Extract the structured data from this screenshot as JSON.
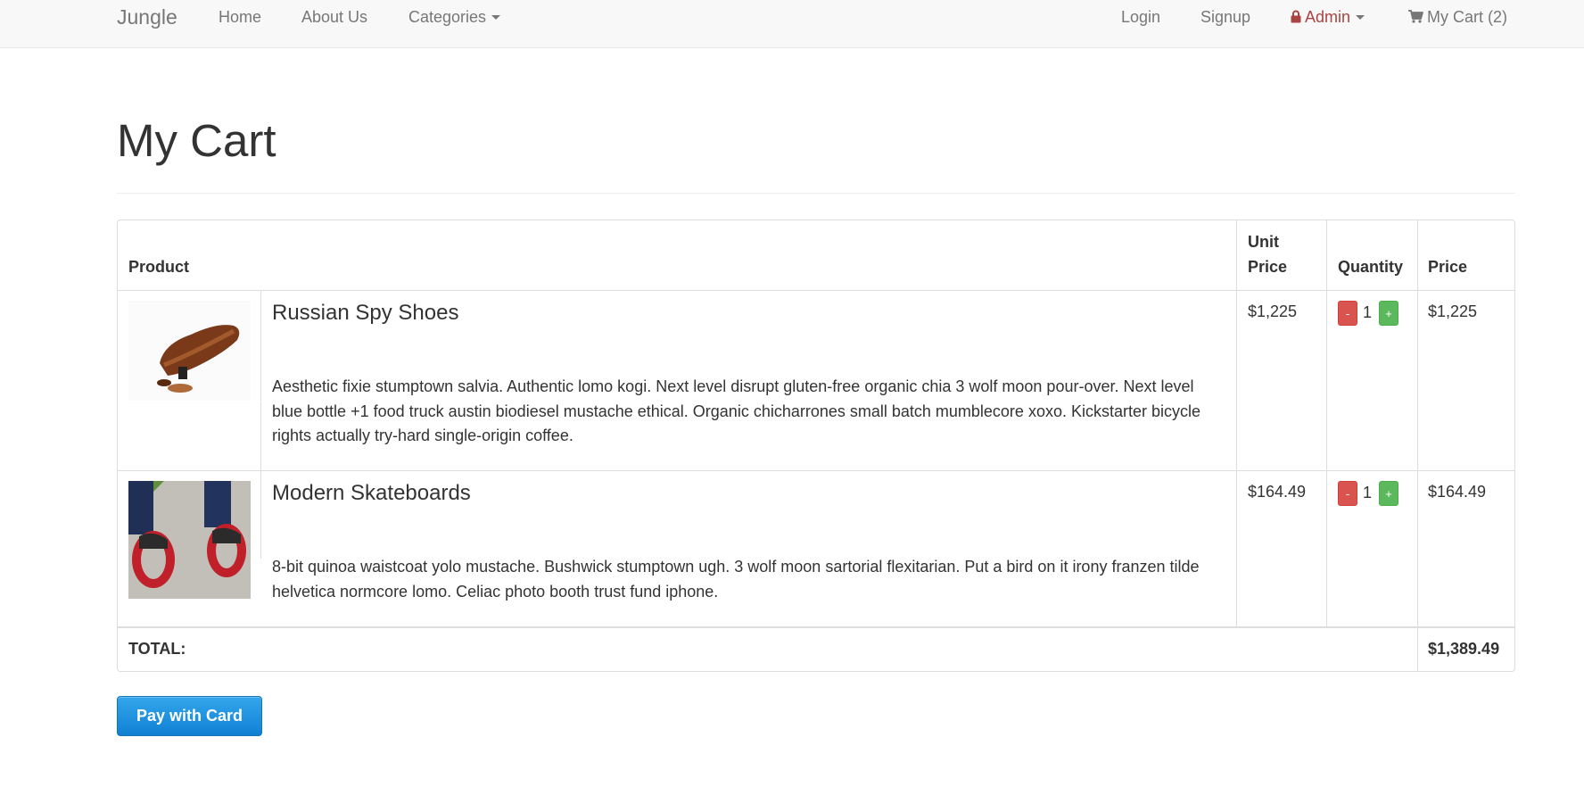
{
  "navbar": {
    "brand": "Jungle",
    "home": "Home",
    "about": "About Us",
    "categories": "Categories",
    "login": "Login",
    "signup": "Signup",
    "admin": "Admin",
    "cart": "My Cart (2)",
    "admin_color": "#a94442",
    "icons": [
      "caret-down-icon",
      "lock-icon",
      "shopping-cart-icon"
    ]
  },
  "page": {
    "title": "My Cart"
  },
  "table": {
    "headers": {
      "product": "Product",
      "unit_price_line1": "Unit",
      "unit_price_line2": "Price",
      "quantity": "Quantity",
      "price": "Price"
    },
    "rows": [
      {
        "name": "Russian Spy Shoes",
        "description": "Aesthetic fixie stumptown salvia. Authentic lomo kogi. Next level disrupt gluten-free organic chia 3 wolf moon pour-over. Next level blue bottle +1 food truck austin biodiesel mustache ethical. Organic chicharrones small batch mumblecore xoxo. Kickstarter bicycle rights actually try-hard single-origin coffee.",
        "unit_price": "$1,225",
        "quantity": "1",
        "price": "$1,225"
      },
      {
        "name": "Modern Skateboards",
        "description": "8-bit quinoa waistcoat yolo mustache. Bushwick stumptown ugh. 3 wolf moon sartorial flexitarian. Put a bird on it irony franzen tilde helvetica normcore lomo. Celiac photo booth trust fund iphone.",
        "unit_price": "$164.49",
        "quantity": "1",
        "price": "$164.49"
      }
    ],
    "decrement_label": "-",
    "increment_label": "+",
    "total_label": "TOTAL:",
    "total_value": "$1,389.49",
    "colors": {
      "decrement": "#d9534f",
      "increment": "#5cb85c"
    }
  },
  "pay_button": {
    "label": "Pay with Card",
    "color": "#1a8ee0"
  }
}
